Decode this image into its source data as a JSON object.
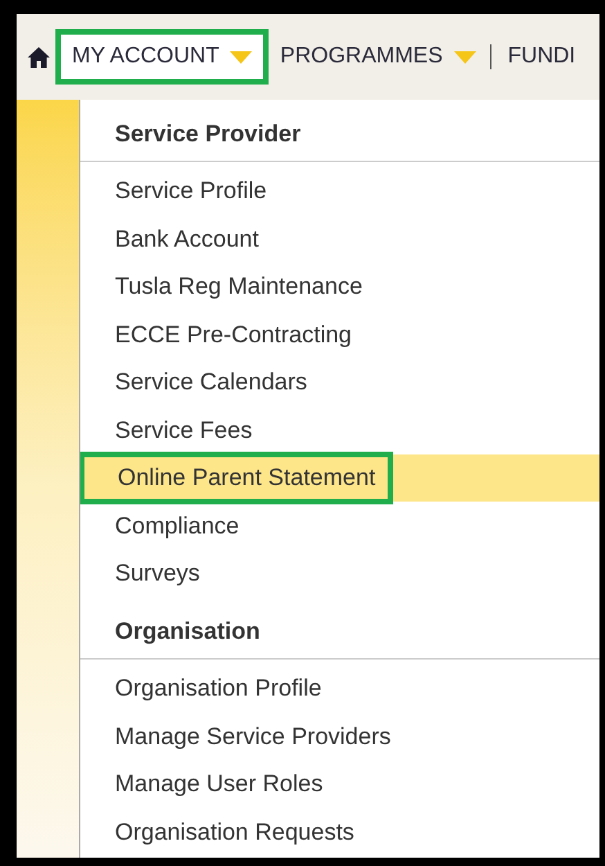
{
  "nav": {
    "items": [
      {
        "kind": "home"
      },
      {
        "kind": "menu",
        "label": "MY ACCOUNT",
        "selected": true,
        "highlighted": true,
        "has_caret": true
      },
      {
        "kind": "menu",
        "label": "PROGRAMMES",
        "selected": false,
        "highlighted": false,
        "has_caret": true
      },
      {
        "kind": "menu",
        "label": "FUNDI",
        "selected": false,
        "highlighted": false,
        "has_caret": false
      }
    ]
  },
  "dropdown": {
    "sections": [
      {
        "title": "Service Provider",
        "items": [
          {
            "label": "Service Profile",
            "selected": false,
            "highlighted": false
          },
          {
            "label": "Bank Account",
            "selected": false,
            "highlighted": false
          },
          {
            "label": "Tusla Reg Maintenance",
            "selected": false,
            "highlighted": false
          },
          {
            "label": "ECCE Pre-Contracting",
            "selected": false,
            "highlighted": false
          },
          {
            "label": "Service Calendars",
            "selected": false,
            "highlighted": false
          },
          {
            "label": "Service Fees",
            "selected": false,
            "highlighted": false
          },
          {
            "label": "Online Parent Statement",
            "selected": true,
            "highlighted": true
          },
          {
            "label": "Compliance",
            "selected": false,
            "highlighted": false
          },
          {
            "label": "Surveys",
            "selected": false,
            "highlighted": false
          }
        ]
      },
      {
        "title": "Organisation",
        "items": [
          {
            "label": "Organisation Profile",
            "selected": false,
            "highlighted": false
          },
          {
            "label": "Manage Service Providers",
            "selected": false,
            "highlighted": false
          },
          {
            "label": "Manage User Roles",
            "selected": false,
            "highlighted": false
          },
          {
            "label": "Organisation Requests",
            "selected": false,
            "highlighted": false
          }
        ]
      }
    ]
  }
}
